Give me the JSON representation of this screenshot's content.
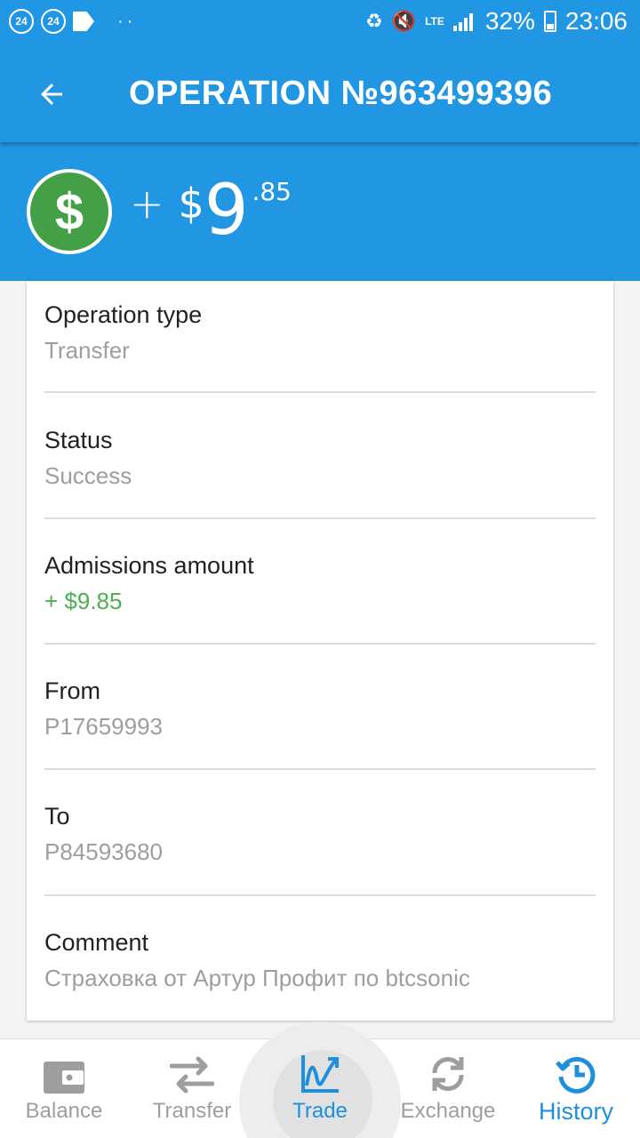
{
  "status_bar": {
    "notif_badge_1": "24",
    "notif_badge_2": "24",
    "dots": "··",
    "network": "LTE",
    "battery": "32%",
    "time": "23:06"
  },
  "header": {
    "title": "OPERATION №963499396"
  },
  "amount": {
    "sign": "+",
    "currency": "$",
    "integer": "9",
    "fraction": ".85",
    "coin_symbol": "$"
  },
  "details": [
    {
      "label": "Operation type",
      "value": "Transfer"
    },
    {
      "label": "Status",
      "value": "Success"
    },
    {
      "label": "Admissions amount",
      "value": "+ $9.85"
    },
    {
      "label": "From",
      "value": "P17659993"
    },
    {
      "label": "To",
      "value": "P84593680"
    },
    {
      "label": "Comment",
      "value": "Страховка от Артур Профит по btcsonic"
    }
  ],
  "nav": [
    {
      "label": "Balance",
      "icon": "wallet-icon"
    },
    {
      "label": "Transfer",
      "icon": "transfer-arrows-icon"
    },
    {
      "label": "Trade",
      "icon": "chart-trade-icon"
    },
    {
      "label": "Exchange",
      "icon": "exchange-refresh-icon"
    },
    {
      "label": "History",
      "icon": "history-clock-icon"
    }
  ],
  "colors": {
    "primary": "#2196e3",
    "accent_green": "#4caf50",
    "coin_green": "#43a047",
    "active_nav": "#1e8fdc",
    "muted_text": "#9e9e9e"
  }
}
